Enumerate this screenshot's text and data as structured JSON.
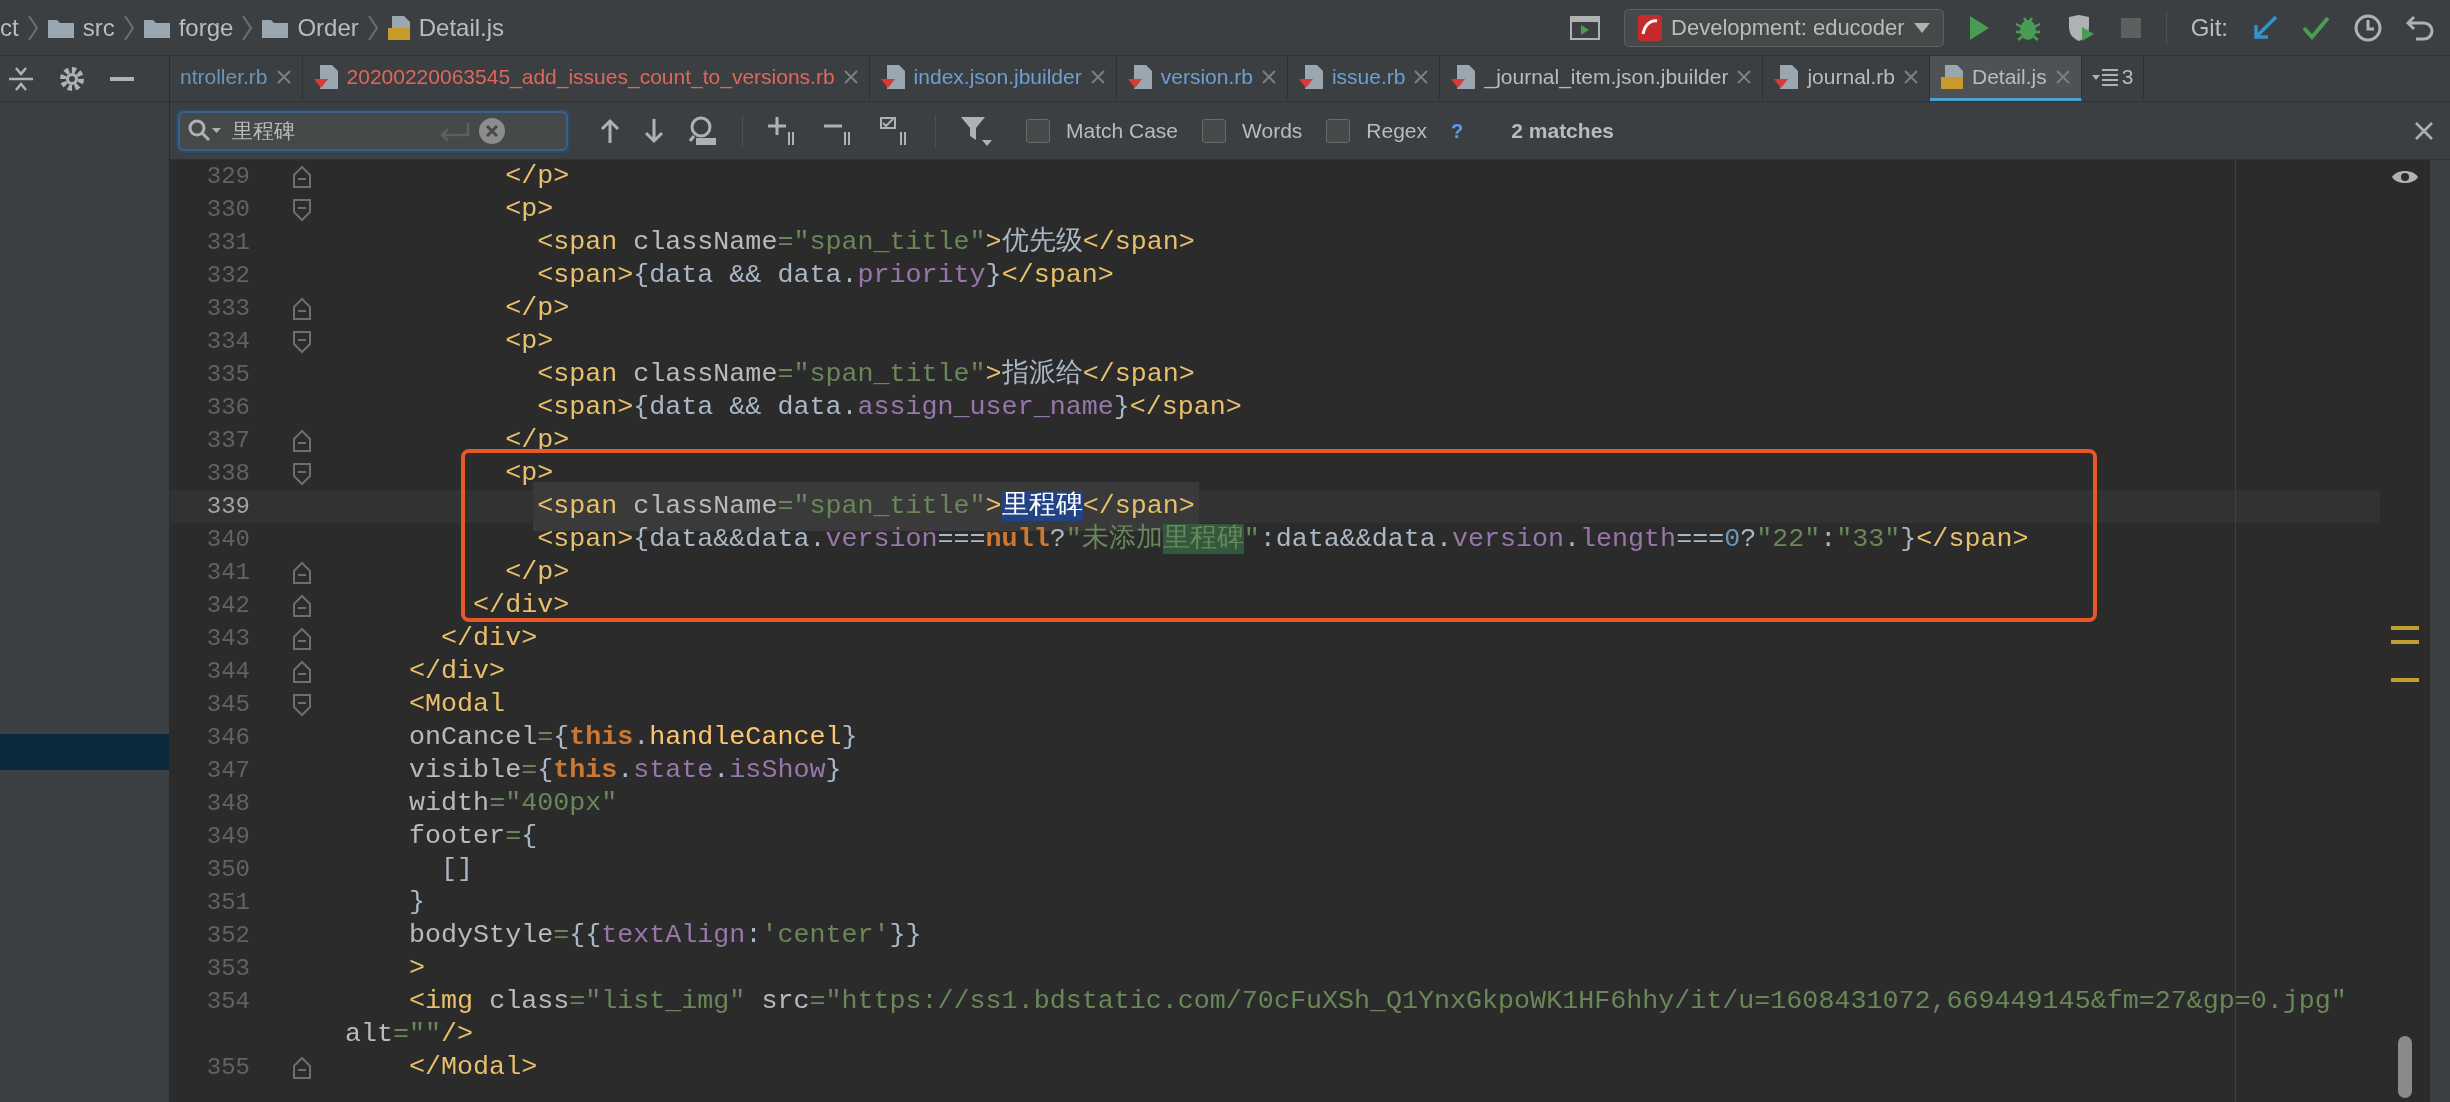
{
  "breadcrumbs": [
    {
      "kind": "text",
      "label": "ct"
    },
    {
      "kind": "folder",
      "label": "src"
    },
    {
      "kind": "folder",
      "label": "forge"
    },
    {
      "kind": "folder",
      "label": "Order"
    },
    {
      "kind": "js",
      "label": "Detail.js"
    }
  ],
  "run_config": {
    "label": "Development: educoder"
  },
  "git_label": "Git:",
  "project_panel": {
    "has_selection": true
  },
  "tabs": [
    {
      "label": "ntroller.rb",
      "kind": "plain",
      "color": "#6897bb",
      "selected": false
    },
    {
      "label": "20200220063545_add_issues_count_to_versions.rb",
      "kind": "ruby",
      "color": "#e0675c",
      "selected": false
    },
    {
      "label": "index.json.jbuilder",
      "kind": "ruby",
      "color": "#6e9fd3",
      "selected": false
    },
    {
      "label": "version.rb",
      "kind": "ruby",
      "color": "#6e9fd3",
      "selected": false
    },
    {
      "label": "issue.rb",
      "kind": "ruby",
      "color": "#6e9fd3",
      "selected": false
    },
    {
      "label": "_journal_item.json.jbuilder",
      "kind": "ruby",
      "color": "#bbbbbb",
      "selected": false
    },
    {
      "label": "journal.rb",
      "kind": "ruby",
      "color": "#bbbbbb",
      "selected": false
    },
    {
      "label": "Detail.js",
      "kind": "js",
      "color": "#bbbbbb",
      "selected": true
    }
  ],
  "tab_overflow": {
    "count": "3"
  },
  "search": {
    "value": "里程碑",
    "options": [
      {
        "label": "Match Case",
        "checked": false
      },
      {
        "label": "Words",
        "checked": false
      },
      {
        "label": "Regex",
        "checked": false
      }
    ],
    "help": "?",
    "result": "2 matches"
  },
  "code_lines": [
    {
      "number": "329",
      "kind": "fold-end",
      "current": false,
      "tokens": [
        {
          "kind": "tag",
          "text": "          </p>"
        }
      ]
    },
    {
      "number": "330",
      "kind": "fold-start",
      "current": false,
      "tokens": [
        {
          "kind": "tag",
          "text": "          <p>"
        }
      ]
    },
    {
      "number": "331",
      "kind": "plain",
      "current": false,
      "tokens": [
        {
          "kind": "tag",
          "text": "            <span "
        },
        {
          "kind": "attr",
          "text": "className"
        },
        {
          "kind": "str",
          "text": "=\"span_title\""
        },
        {
          "kind": "tag",
          "text": ">"
        },
        {
          "kind": "plain",
          "text": "优先级"
        },
        {
          "kind": "tag",
          "text": "</span>"
        }
      ]
    },
    {
      "number": "332",
      "kind": "plain",
      "current": false,
      "tokens": [
        {
          "kind": "tag",
          "text": "            <span>"
        },
        {
          "kind": "plain",
          "text": "{data && data."
        },
        {
          "kind": "prop",
          "text": "priority"
        },
        {
          "kind": "plain",
          "text": "}"
        },
        {
          "kind": "tag",
          "text": "</span>"
        }
      ]
    },
    {
      "number": "333",
      "kind": "fold-end",
      "current": false,
      "tokens": [
        {
          "kind": "tag",
          "text": "          </p>"
        }
      ]
    },
    {
      "number": "334",
      "kind": "fold-start",
      "current": false,
      "tokens": [
        {
          "kind": "tag",
          "text": "          <p>"
        }
      ]
    },
    {
      "number": "335",
      "kind": "plain",
      "current": false,
      "tokens": [
        {
          "kind": "tag",
          "text": "            <span "
        },
        {
          "kind": "attr",
          "text": "className"
        },
        {
          "kind": "str",
          "text": "=\"span_title\""
        },
        {
          "kind": "tag",
          "text": ">"
        },
        {
          "kind": "plain",
          "text": "指派给"
        },
        {
          "kind": "tag",
          "text": "</span>"
        }
      ]
    },
    {
      "number": "336",
      "kind": "plain",
      "current": false,
      "tokens": [
        {
          "kind": "tag",
          "text": "            <span>"
        },
        {
          "kind": "plain",
          "text": "{data && data."
        },
        {
          "kind": "prop",
          "text": "assign_user_name"
        },
        {
          "kind": "plain",
          "text": "}"
        },
        {
          "kind": "tag",
          "text": "</span>"
        }
      ]
    },
    {
      "number": "337",
      "kind": "fold-end",
      "current": false,
      "tokens": [
        {
          "kind": "tag",
          "text": "          </p>"
        }
      ]
    },
    {
      "number": "338",
      "kind": "fold-start",
      "current": false,
      "tokens": [
        {
          "kind": "tag",
          "text": "          <p>"
        }
      ]
    },
    {
      "number": "339",
      "kind": "plain",
      "current": true,
      "tokens": [
        {
          "kind": "tag",
          "text": "            <span "
        },
        {
          "kind": "attr",
          "text": "className"
        },
        {
          "kind": "str",
          "text": "=\"span_title\""
        },
        {
          "kind": "tag",
          "text": ">"
        },
        {
          "kind": "plain",
          "text": "里程碑",
          "selected": true
        },
        {
          "kind": "tag",
          "text": "</span>"
        }
      ]
    },
    {
      "number": "340",
      "kind": "plain",
      "current": false,
      "tokens": [
        {
          "kind": "tag",
          "text": "            <span>"
        },
        {
          "kind": "plain",
          "text": "{data&&data."
        },
        {
          "kind": "prop",
          "text": "version"
        },
        {
          "kind": "plain",
          "text": "==="
        },
        {
          "kind": "kw",
          "text": "null"
        },
        {
          "kind": "plain",
          "text": "?"
        },
        {
          "kind": "str",
          "text": "\"未添加"
        },
        {
          "kind": "str",
          "text": "里程碑",
          "matched": true
        },
        {
          "kind": "str",
          "text": "\""
        },
        {
          "kind": "plain",
          "text": ":data&&data."
        },
        {
          "kind": "prop",
          "text": "version"
        },
        {
          "kind": "plain",
          "text": "."
        },
        {
          "kind": "prop",
          "text": "length"
        },
        {
          "kind": "plain",
          "text": "==="
        },
        {
          "kind": "num",
          "text": "0"
        },
        {
          "kind": "plain",
          "text": "?"
        },
        {
          "kind": "str",
          "text": "\"22\""
        },
        {
          "kind": "plain",
          "text": ":"
        },
        {
          "kind": "str",
          "text": "\"33\""
        },
        {
          "kind": "plain",
          "text": "}"
        },
        {
          "kind": "tag",
          "text": "</span>"
        }
      ]
    },
    {
      "number": "341",
      "kind": "fold-end",
      "current": false,
      "tokens": [
        {
          "kind": "tag",
          "text": "          </p>"
        }
      ]
    },
    {
      "number": "342",
      "kind": "fold-end",
      "current": false,
      "tokens": [
        {
          "kind": "tag",
          "text": "        </div>"
        }
      ]
    },
    {
      "number": "343",
      "kind": "fold-end",
      "current": false,
      "tokens": [
        {
          "kind": "tag",
          "text": "      </div>"
        }
      ]
    },
    {
      "number": "344",
      "kind": "fold-end",
      "current": false,
      "tokens": [
        {
          "kind": "tag",
          "text": "    </div>"
        }
      ]
    },
    {
      "number": "345",
      "kind": "fold-start",
      "current": false,
      "tokens": [
        {
          "kind": "tag",
          "text": "    <Modal"
        }
      ]
    },
    {
      "number": "346",
      "kind": "plain",
      "current": false,
      "tokens": [
        {
          "kind": "attr",
          "text": "    onCancel"
        },
        {
          "kind": "str",
          "text": "="
        },
        {
          "kind": "plain",
          "text": "{"
        },
        {
          "kind": "kw",
          "text": "this"
        },
        {
          "kind": "plain",
          "text": "."
        },
        {
          "kind": "fn",
          "text": "handleCancel"
        },
        {
          "kind": "plain",
          "text": "}"
        }
      ]
    },
    {
      "number": "347",
      "kind": "plain",
      "current": false,
      "tokens": [
        {
          "kind": "attr",
          "text": "    visible"
        },
        {
          "kind": "str",
          "text": "="
        },
        {
          "kind": "plain",
          "text": "{"
        },
        {
          "kind": "kw",
          "text": "this"
        },
        {
          "kind": "plain",
          "text": "."
        },
        {
          "kind": "prop",
          "text": "state"
        },
        {
          "kind": "plain",
          "text": "."
        },
        {
          "kind": "prop",
          "text": "isShow"
        },
        {
          "kind": "plain",
          "text": "}"
        }
      ]
    },
    {
      "number": "348",
      "kind": "plain",
      "current": false,
      "tokens": [
        {
          "kind": "attr",
          "text": "    width"
        },
        {
          "kind": "str",
          "text": "=\"400px\""
        }
      ]
    },
    {
      "number": "349",
      "kind": "plain",
      "current": false,
      "tokens": [
        {
          "kind": "attr",
          "text": "    footer"
        },
        {
          "kind": "str",
          "text": "="
        },
        {
          "kind": "plain",
          "text": "{"
        }
      ]
    },
    {
      "number": "350",
      "kind": "plain",
      "current": false,
      "tokens": [
        {
          "kind": "plain",
          "text": "      []"
        }
      ]
    },
    {
      "number": "351",
      "kind": "plain",
      "current": false,
      "tokens": [
        {
          "kind": "plain",
          "text": "    }"
        }
      ]
    },
    {
      "number": "352",
      "kind": "plain",
      "current": false,
      "tokens": [
        {
          "kind": "attr",
          "text": "    bodyStyle"
        },
        {
          "kind": "str",
          "text": "="
        },
        {
          "kind": "plain",
          "text": "{{"
        },
        {
          "kind": "prop",
          "text": "textAlign"
        },
        {
          "kind": "plain",
          "text": ":"
        },
        {
          "kind": "str",
          "text": "'center'"
        },
        {
          "kind": "plain",
          "text": "}}"
        }
      ]
    },
    {
      "number": "353",
      "kind": "plain",
      "current": false,
      "tokens": [
        {
          "kind": "tag",
          "text": "    >"
        }
      ]
    },
    {
      "number": "354",
      "kind": "plain",
      "current": false,
      "tokens": [
        {
          "kind": "tag",
          "text": "    <img "
        },
        {
          "kind": "attr",
          "text": "class"
        },
        {
          "kind": "str",
          "text": "=\"list_img\" "
        },
        {
          "kind": "attr",
          "text": "src"
        },
        {
          "kind": "str",
          "text": "=\"https://ss1.bdstatic.com/70cFuXSh_Q1YnxGkpoWK1HF6hhy/it/u=1608431072,669449145&fm=27&gp=0.jpg\""
        }
      ]
    },
    {
      "kind": "wrapped",
      "current": false,
      "tokens": [
        {
          "kind": "attr",
          "text": "alt"
        },
        {
          "kind": "str",
          "text": "=\"\""
        },
        {
          "kind": "tag",
          "text": "/>"
        }
      ]
    },
    {
      "number": "355",
      "kind": "fold-end",
      "current": false,
      "tokens": [
        {
          "kind": "tag",
          "text": "    </Modal>"
        }
      ]
    }
  ]
}
